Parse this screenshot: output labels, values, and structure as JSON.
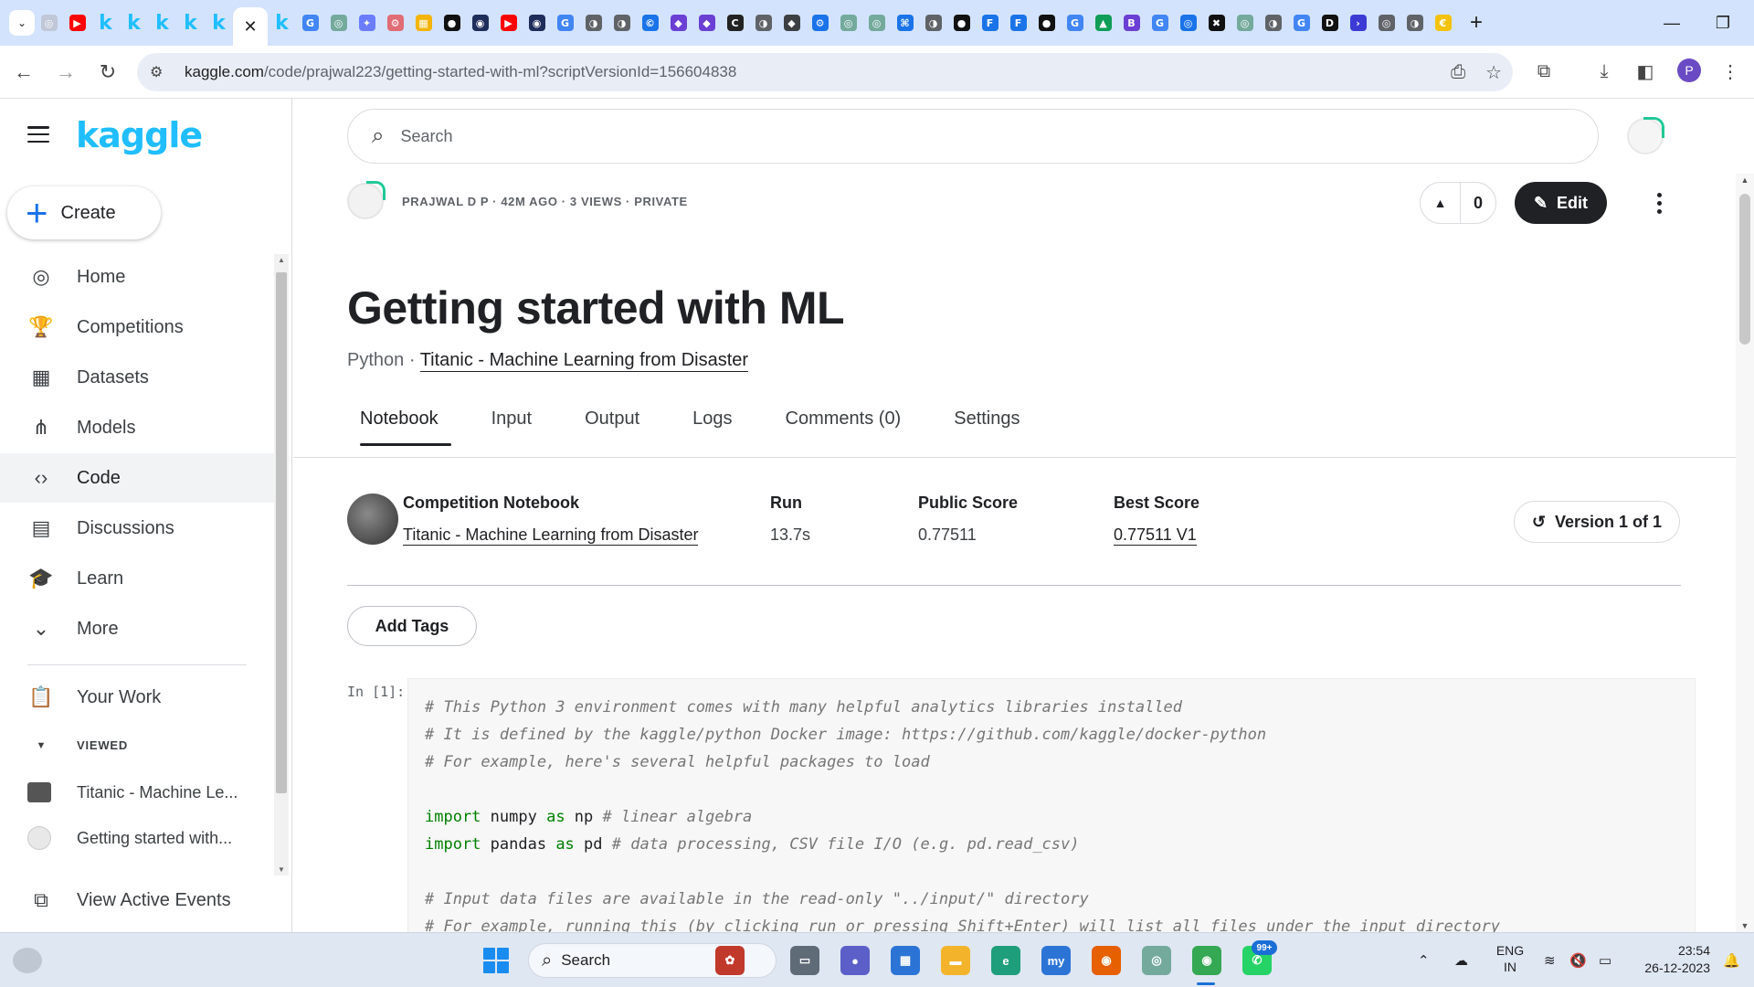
{
  "browser": {
    "tab_favicons": [
      {
        "name": "favicon-generic",
        "color": "#c0c7d6",
        "glyph": "◎"
      },
      {
        "name": "youtube-favicon",
        "color": "#ff0000",
        "glyph": "▶"
      },
      {
        "name": "kaggle-favicon",
        "kaggle": true,
        "glyph": "k"
      },
      {
        "name": "kaggle-favicon",
        "kaggle": true,
        "glyph": "k"
      },
      {
        "name": "kaggle-favicon",
        "kaggle": true,
        "glyph": "k"
      },
      {
        "name": "kaggle-favicon",
        "kaggle": true,
        "glyph": "k"
      },
      {
        "name": "kaggle-favicon",
        "kaggle": true,
        "glyph": "k"
      },
      {
        "name": "active-tab-close-icon",
        "active": true,
        "glyph": "✕"
      },
      {
        "name": "kaggle-favicon",
        "kaggle": true,
        "glyph": "k"
      },
      {
        "name": "google-favicon",
        "color": "#4285f4",
        "glyph": "G"
      },
      {
        "name": "chatgpt-favicon",
        "color": "#74aa9c",
        "glyph": "◎"
      },
      {
        "name": "gemini-favicon",
        "color": "#6b7cff",
        "glyph": "✦"
      },
      {
        "name": "favicon-generic",
        "color": "#e06c75",
        "glyph": "⚙"
      },
      {
        "name": "favicon-generic",
        "color": "#f4b400",
        "glyph": "▦"
      },
      {
        "name": "medium-favicon",
        "color": "#111111",
        "glyph": "●"
      },
      {
        "name": "favicon-generic",
        "color": "#1f2d5a",
        "glyph": "◉"
      },
      {
        "name": "youtube-favicon",
        "color": "#ff0000",
        "glyph": "▶"
      },
      {
        "name": "favicon-generic",
        "color": "#1f2d5a",
        "glyph": "◉"
      },
      {
        "name": "google-favicon",
        "color": "#4285f4",
        "glyph": "G"
      },
      {
        "name": "favicon-generic",
        "color": "#5f6368",
        "glyph": "◑"
      },
      {
        "name": "favicon-generic",
        "color": "#5f6368",
        "glyph": "◑"
      },
      {
        "name": "favicon-generic",
        "color": "#1a73e8",
        "glyph": "©"
      },
      {
        "name": "favicon-generic",
        "color": "#6b3fd4",
        "glyph": "◆"
      },
      {
        "name": "favicon-generic",
        "color": "#6b3fd4",
        "glyph": "◆"
      },
      {
        "name": "favicon-generic",
        "color": "#222222",
        "glyph": "C"
      },
      {
        "name": "favicon-generic",
        "color": "#5f6368",
        "glyph": "◑"
      },
      {
        "name": "favicon-generic",
        "color": "#3c4043",
        "glyph": "◆"
      },
      {
        "name": "favicon-generic",
        "color": "#1a73e8",
        "glyph": "⚙"
      },
      {
        "name": "chatgpt-favicon",
        "color": "#74aa9c",
        "glyph": "◎"
      },
      {
        "name": "chatgpt-favicon",
        "color": "#74aa9c",
        "glyph": "◎"
      },
      {
        "name": "favicon-generic",
        "color": "#1a73e8",
        "glyph": "⌘"
      },
      {
        "name": "favicon-generic",
        "color": "#5f6368",
        "glyph": "◑"
      },
      {
        "name": "github-favicon",
        "color": "#111111",
        "glyph": "●"
      },
      {
        "name": "favicon-generic",
        "color": "#1a73e8",
        "glyph": "F"
      },
      {
        "name": "favicon-generic",
        "color": "#1a73e8",
        "glyph": "F"
      },
      {
        "name": "github-favicon",
        "color": "#111111",
        "glyph": "●"
      },
      {
        "name": "google-favicon",
        "color": "#4285f4",
        "glyph": "G"
      },
      {
        "name": "drive-favicon",
        "color": "#0f9d58",
        "glyph": "▲"
      },
      {
        "name": "favicon-generic",
        "color": "#6b3fd4",
        "glyph": "B"
      },
      {
        "name": "google-favicon",
        "color": "#4285f4",
        "glyph": "G"
      },
      {
        "name": "favicon-generic",
        "color": "#1a73e8",
        "glyph": "◎"
      },
      {
        "name": "favicon-generic",
        "color": "#111111",
        "glyph": "✖"
      },
      {
        "name": "chatgpt-favicon",
        "color": "#74aa9c",
        "glyph": "◎"
      },
      {
        "name": "favicon-generic",
        "color": "#5f6368",
        "glyph": "◑"
      },
      {
        "name": "google-favicon",
        "color": "#4285f4",
        "glyph": "G"
      },
      {
        "name": "dev-favicon",
        "color": "#111111",
        "glyph": "D"
      },
      {
        "name": "favicon-generic",
        "color": "#3b3bd4",
        "glyph": "›"
      },
      {
        "name": "favicon-generic",
        "color": "#5f6368",
        "glyph": "◎"
      },
      {
        "name": "favicon-generic",
        "color": "#5f6368",
        "glyph": "◑"
      },
      {
        "name": "favicon-generic",
        "color": "#f4c20d",
        "glyph": "€"
      }
    ],
    "url_host": "kaggle.com",
    "url_path": "/code/prajwal223/getting-started-with-ml?scriptVersionId=156604838",
    "profile_initial": "P"
  },
  "sidebar": {
    "logo": "kaggle",
    "create_label": "Create",
    "items": [
      {
        "name": "home",
        "label": "Home",
        "icon": "◎"
      },
      {
        "name": "competitions",
        "label": "Competitions",
        "icon": "🏆"
      },
      {
        "name": "datasets",
        "label": "Datasets",
        "icon": "▦"
      },
      {
        "name": "models",
        "label": "Models",
        "icon": "⋔"
      },
      {
        "name": "code",
        "label": "Code",
        "icon": "‹›",
        "active": true
      },
      {
        "name": "discussions",
        "label": "Discussions",
        "icon": "▤"
      },
      {
        "name": "learn",
        "label": "Learn",
        "icon": "🎓"
      },
      {
        "name": "more",
        "label": "More",
        "icon": "⌄"
      }
    ],
    "your_work": "Your Work",
    "viewed_header": "VIEWED",
    "viewed_items": [
      "Titanic - Machine Le...",
      "Getting started with..."
    ],
    "view_active_events": "View Active Events"
  },
  "header": {
    "search_placeholder": "Search"
  },
  "notebook": {
    "meta": "PRAJWAL D P · 42M AGO · 3 VIEWS · PRIVATE",
    "vote_count": "0",
    "edit_label": "Edit",
    "title": "Getting started with ML",
    "language": "Python",
    "competition_link": "Titanic - Machine Learning from Disaster",
    "tabs": [
      "Notebook",
      "Input",
      "Output",
      "Logs",
      "Comments (0)",
      "Settings"
    ],
    "active_tab": "Notebook",
    "stats": {
      "competition_header": "Competition Notebook",
      "competition_value": "Titanic - Machine Learning from Disaster",
      "run_header": "Run",
      "run_value": "13.7s",
      "public_header": "Public Score",
      "public_value": "0.77511",
      "best_header": "Best Score",
      "best_value": "0.77511 V1"
    },
    "version_label": "Version 1 of 1",
    "add_tags_label": "Add Tags",
    "cell_label": "In [1]:",
    "code_lines": [
      {
        "type": "comment",
        "text": "# This Python 3 environment comes with many helpful analytics libraries installed"
      },
      {
        "type": "comment",
        "text": "# It is defined by the kaggle/python Docker image: https://github.com/kaggle/docker-python"
      },
      {
        "type": "comment",
        "text": "# For example, here's several helpful packages to load"
      },
      {
        "type": "blank",
        "text": ""
      },
      {
        "type": "import",
        "kw1": "import",
        "mod": " numpy ",
        "kw2": "as",
        "alias": " np ",
        "comment": "# linear algebra"
      },
      {
        "type": "import",
        "kw1": "import",
        "mod": " pandas ",
        "kw2": "as",
        "alias": " pd ",
        "comment": "# data processing, CSV file I/O (e.g. pd.read_csv)"
      },
      {
        "type": "blank",
        "text": ""
      },
      {
        "type": "comment",
        "text": "# Input data files are available in the read-only \"../input/\" directory"
      },
      {
        "type": "comment",
        "text": "# For example, running this (by clicking run or pressing Shift+Enter) will list all files under the input directory"
      }
    ]
  },
  "taskbar": {
    "search_label": "Search",
    "apps": [
      {
        "name": "widgets-app",
        "color": "#c0392b",
        "glyph": "✿"
      },
      {
        "name": "file-explorer-app",
        "color": "#606b78",
        "glyph": "▭"
      },
      {
        "name": "teams-meet-app",
        "color": "#5b5fc7",
        "glyph": "●"
      },
      {
        "name": "store-app",
        "color": "#2b74d6",
        "glyph": "▦"
      },
      {
        "name": "folder-app",
        "color": "#f3b42b",
        "glyph": "▬"
      },
      {
        "name": "edge-app",
        "color": "#1e9e7a",
        "glyph": "e"
      },
      {
        "name": "mysql-app",
        "color": "#2b74d6",
        "glyph": "my"
      },
      {
        "name": "firefox-app",
        "color": "#e66000",
        "glyph": "◉"
      },
      {
        "name": "chatgpt-app",
        "color": "#74aa9c",
        "glyph": "◎"
      },
      {
        "name": "chrome-app",
        "color": "#34a853",
        "glyph": "◉"
      },
      {
        "name": "whatsapp-app",
        "color": "#25d366",
        "glyph": "✆"
      }
    ],
    "whatsapp_badge": "99+",
    "chrome_profile_badge": "P",
    "lang_line1": "ENG",
    "lang_line2": "IN",
    "time": "23:54",
    "date": "26-12-2023"
  }
}
